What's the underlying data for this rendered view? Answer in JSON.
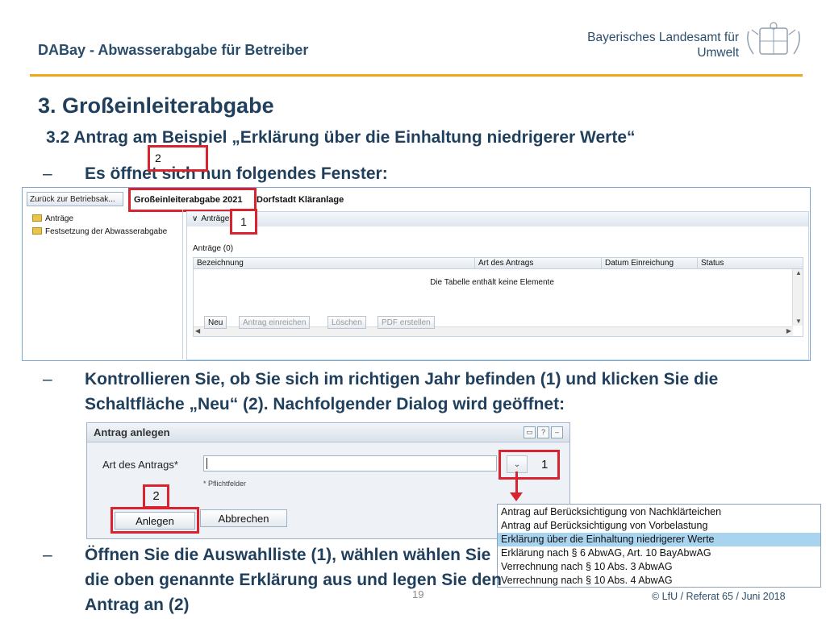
{
  "header": {
    "title": "DABay - Abwasserabgabe für Betreiber",
    "org_line1": "Bayerisches Landesamt für",
    "org_line2": "Umwelt"
  },
  "slide": {
    "title": "3. Großeinleiterabgabe",
    "subtitle": "3.2 Antrag am Beispiel „Erklärung über die Einhaltung niedrigerer Werte“",
    "bullets": [
      "Es öffnet sich nun folgendes Fenster:",
      "Kontrollieren Sie, ob Sie sich im richtigen Jahr befinden (1) und klicken Sie die Schaltfläche „Neu“ (2). Nachfolgender Dialog wird geöffnet:",
      "Öffnen Sie die Auswahlliste (1), wählen wählen Sie die oben genannte Erklärung aus und legen Sie den Antrag an (2)"
    ],
    "dash": "–"
  },
  "app": {
    "back_button": "Zurück zur Betriebsak...",
    "tab_year": "Großeinleiterabgabe 2021",
    "tab_name": "Dorfstadt Kläranlage",
    "tree": [
      "Anträge",
      "Festsetzung der Abwasserabgabe"
    ],
    "panel_title": "Anträge",
    "count_label": "Anträge (0)",
    "columns": [
      "Bezeichnung",
      "Art des Antrags",
      "Datum Einreichung",
      "Status"
    ],
    "empty_message": "Die Tabelle enthält keine Elemente",
    "buttons": {
      "new": "Neu",
      "submit": "Antrag einreichen",
      "delete": "Löschen",
      "pdf": "PDF erstellen"
    },
    "marker_1": "1",
    "marker_2": "2"
  },
  "dialog": {
    "title": "Antrag anlegen",
    "field_label": "Art des Antrags*",
    "required_note": "* Pflichtfelder",
    "create_button": "Anlegen",
    "cancel_button": "Abbrechen",
    "marker_1": "1",
    "marker_2": "2",
    "options": [
      "Antrag auf Berücksichtigung von Nachklärteichen",
      "Antrag auf Berücksichtigung von Vorbelastung",
      "Erklärung über die Einhaltung niedrigerer Werte",
      "Erklärung nach § 6 AbwAG, Art. 10 BayAbwAG",
      "Verrechnung nach § 10 Abs. 3 AbwAG",
      "Verrechnung nach § 10 Abs. 4 AbwAG"
    ],
    "selected_option": "Erklärung über die Einhaltung niedrigerer Werte"
  },
  "footer": {
    "copyright": "© LfU / Referat 65 / Juni 2018",
    "page": "19"
  },
  "colors": {
    "accent_line": "#f0a81b",
    "highlight": "#d9232e",
    "text": "#1f3f5c",
    "selection": "#a9d4ef"
  }
}
